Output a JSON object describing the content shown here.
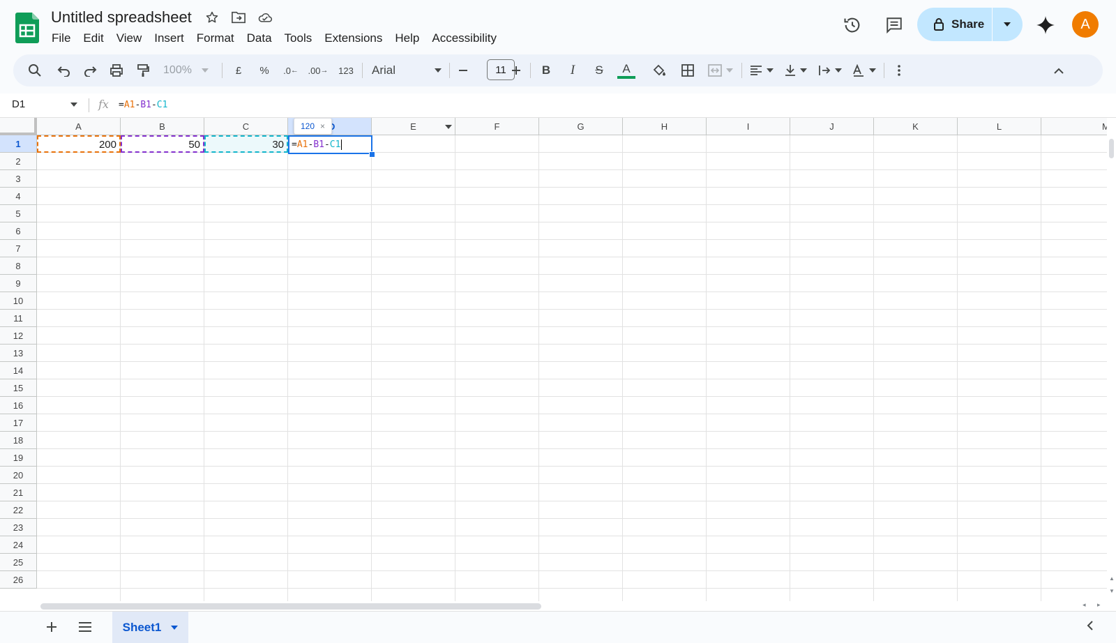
{
  "app": {
    "title": "Untitled spreadsheet"
  },
  "menus": [
    "File",
    "Edit",
    "View",
    "Insert",
    "Format",
    "Data",
    "Tools",
    "Extensions",
    "Help",
    "Accessibility"
  ],
  "header": {
    "share_label": "Share",
    "avatar_letter": "A"
  },
  "toolbar": {
    "zoom": "100%",
    "currency": "£",
    "percent": "%",
    "decrease_decimal": ".0",
    "increase_decimal": ".00",
    "format_number": "123",
    "font": "Arial",
    "font_size": "11"
  },
  "formula_bar": {
    "cell_ref": "D1",
    "fx": "fx",
    "formula_eq": "=",
    "formula_a": "A1",
    "formula_op1": "-",
    "formula_b": "B1",
    "formula_op2": "-",
    "formula_c": "C1"
  },
  "grid": {
    "columns": [
      "A",
      "B",
      "C",
      "D",
      "E",
      "F",
      "G",
      "H",
      "I",
      "J",
      "K",
      "L",
      "M"
    ],
    "rows": [
      "1",
      "2",
      "3",
      "4",
      "5",
      "6",
      "7",
      "8",
      "9",
      "10",
      "11",
      "12",
      "13",
      "14",
      "15",
      "16",
      "17",
      "18",
      "19",
      "20",
      "21",
      "22",
      "23",
      "24",
      "25",
      "26"
    ],
    "cells": {
      "A1": "200",
      "B1": "50",
      "C1": "30"
    },
    "preview_value": "120",
    "preview_close": "×"
  },
  "sheets": {
    "active": "Sheet1"
  },
  "colors": {
    "ref_a": "#e8710a",
    "ref_b": "#8430ce",
    "ref_c": "#12b5cb",
    "selection": "#1a73e8"
  }
}
